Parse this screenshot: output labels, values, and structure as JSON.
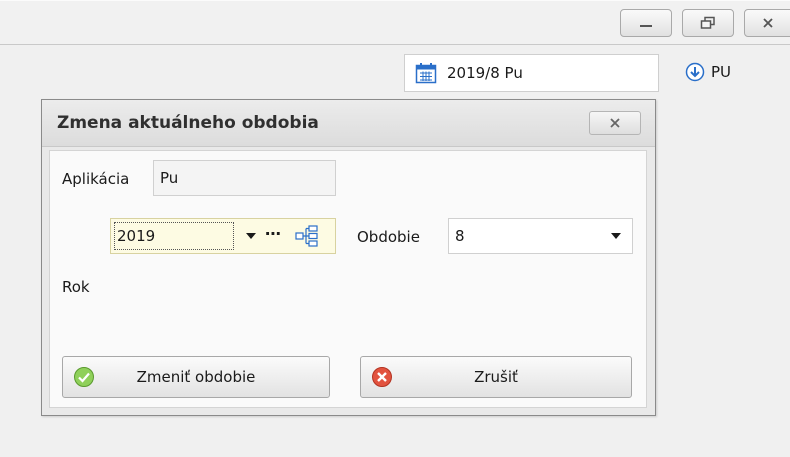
{
  "window_controls": {
    "minimize_icon": "minimize-icon",
    "restore_icon": "restore-icon",
    "close_icon": "close-icon"
  },
  "header": {
    "period_value": "2019/8 Pu",
    "user_label": "PU"
  },
  "dialog": {
    "title": "Zmena aktuálneho obdobia",
    "aplikacia_label": "Aplikácia",
    "aplikacia_value": "Pu",
    "rok_label": "Rok",
    "rok_value": "2019",
    "obdobie_label": "Obdobie",
    "obdobie_value": "8",
    "ellipsis": "⋯",
    "confirm_label": "Zmeniť obdobie",
    "cancel_label": "Zrušiť"
  },
  "colors": {
    "accent_blue": "#2a6fc9",
    "ok_green": "#6bbf3a",
    "cancel_red": "#d9412f",
    "highlight_field": "#fdfbe3"
  }
}
